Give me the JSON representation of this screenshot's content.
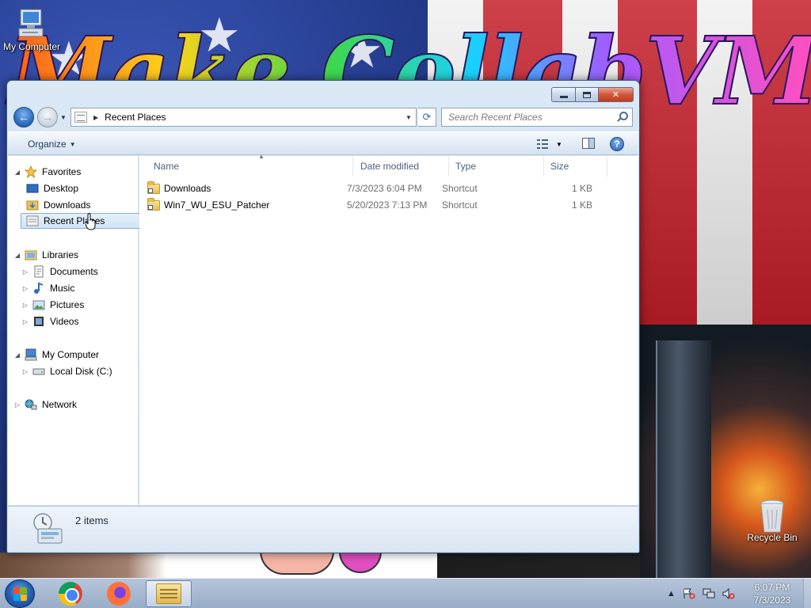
{
  "desktop": {
    "wallpaper_text": "Make CollabVM Great Again!",
    "icons": [
      {
        "label": "My Computer"
      },
      {
        "label": "Recycle Bin"
      }
    ]
  },
  "window": {
    "address": {
      "location": "Recent Places"
    },
    "search": {
      "placeholder": "Search Recent Places"
    },
    "commandbar": {
      "organize_label": "Organize"
    },
    "navpane": {
      "favorites": {
        "label": "Favorites",
        "items": [
          "Desktop",
          "Downloads",
          "Recent Places"
        ]
      },
      "libraries": {
        "label": "Libraries",
        "items": [
          "Documents",
          "Music",
          "Pictures",
          "Videos"
        ]
      },
      "computer": {
        "label": "My Computer",
        "items": [
          "Local Disk (C:)"
        ]
      },
      "network": {
        "label": "Network"
      }
    },
    "columns": {
      "name": "Name",
      "date": "Date modified",
      "type": "Type",
      "size": "Size"
    },
    "files": [
      {
        "name": "Downloads",
        "date": "7/3/2023 6:04 PM",
        "type": "Shortcut",
        "size": "1 KB"
      },
      {
        "name": "Win7_WU_ESU_Patcher",
        "date": "5/20/2023 7:13 PM",
        "type": "Shortcut",
        "size": "1 KB"
      }
    ],
    "details": {
      "count": "2 items"
    }
  },
  "taskbar": {
    "apps": [
      "chrome-icon",
      "firefox-icon",
      "explorer-icon"
    ],
    "clock": {
      "time": "6:07 PM",
      "date": "7/3/2023"
    }
  },
  "colors": {
    "accent": "#2e6ec1",
    "selection": "#cfe4f7",
    "flag_red": "#c51f2a"
  }
}
